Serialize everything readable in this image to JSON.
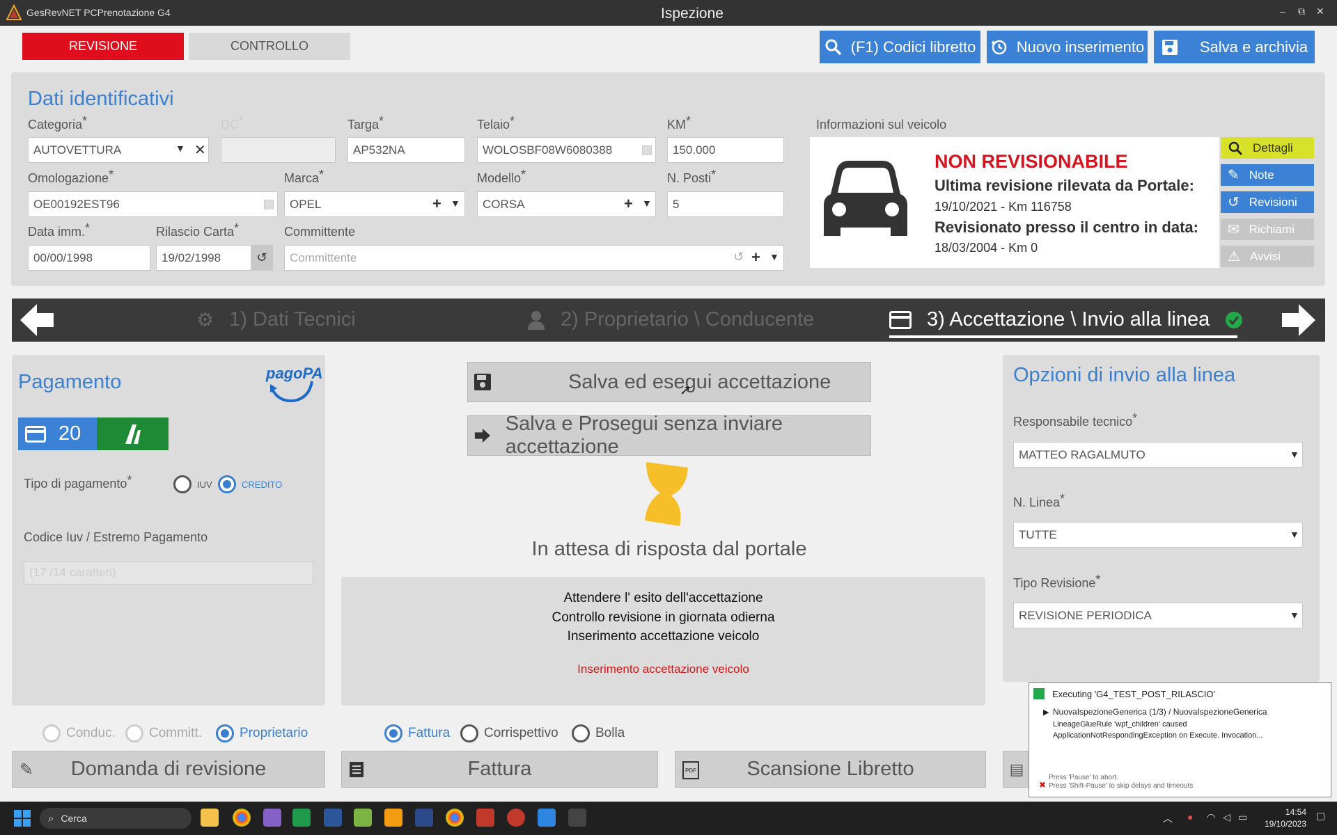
{
  "window": {
    "app_title": "GesRevNET PCPrenotazione G4",
    "title": "Ispezione",
    "controls": [
      "–",
      "⧉",
      "✕"
    ]
  },
  "header": {
    "tab_revisione": "REVISIONE",
    "tab_controllo": "CONTROLLO",
    "btn_codici": "(F1) Codici libretto",
    "btn_nuovo": "Nuovo inserimento",
    "btn_salva": "Salva e archivia"
  },
  "dati": {
    "title": "Dati identificativi",
    "categoria_label": "Categoria",
    "categoria_value": "AUTOVETTURA",
    "dc_label": "DC",
    "targa_label": "Targa",
    "targa_value": "AP532NA",
    "telaio_label": "Telaio",
    "telaio_value": "WOLOSBF08W6080388",
    "km_label": "KM",
    "km_value": "150.000",
    "omologazione_label": "Omologazione",
    "omologazione_value": "OE00192EST96",
    "marca_label": "Marca",
    "marca_value": "OPEL",
    "modello_label": "Modello",
    "modello_value": "CORSA",
    "posti_label": "N. Posti",
    "posti_value": "5",
    "data_imm_label": "Data imm.",
    "data_imm_value": "00/00/1998",
    "rilascio_label": "Rilascio Carta",
    "rilascio_value": "19/02/1998",
    "committente_label": "Committente",
    "committente_placeholder": "Committente",
    "required": "*"
  },
  "vehicle_info": {
    "label": "Informazioni sul veicolo",
    "status": "NON REVISIONABILE",
    "line1": "Ultima revisione rilevata da Portale:",
    "line1_value": "19/10/2021 - Km 116758",
    "line2": "Revisionato presso il centro in data:",
    "line2_value": "18/03/2004 - Km 0",
    "btn_dettagli": "Dettagli",
    "btn_note": "Note",
    "btn_revisioni": "Revisioni",
    "btn_richiami": "Richiami",
    "btn_avvisi": "Avvisi"
  },
  "steps": {
    "step1": "1) Dati Tecnici",
    "step2": "2) Proprietario \\ Conducente",
    "step3": "3) Accettazione \\ Invio alla linea"
  },
  "pagamento": {
    "title": "Pagamento",
    "logo": "pagoPA",
    "card_count": "20",
    "tipo_label": "Tipo di pagamento",
    "opt_iuv": "IUV",
    "opt_credito": "CREDITO",
    "codice_label": "Codice Iuv / Estremo Pagamento",
    "codice_placeholder": "(17 /14 caratteri)"
  },
  "center": {
    "btn_accettazione": "Salva ed esegui accettazione",
    "btn_prosegui": "Salva e Prosegui senza inviare accettazione",
    "waiting": "In attesa di risposta dal portale",
    "msg1": "Attendere l' esito dell'accettazione",
    "msg2": "Controllo revisione in giornata odierna",
    "msg3": "Inserimento accettazione veicolo",
    "msg_red": "Inserimento accettazione veicolo"
  },
  "opzioni": {
    "title": "Opzioni di invio alla linea",
    "resp_label": "Responsabile tecnico",
    "resp_value": "MATTEO RAGALMUTO",
    "linea_label": "N. Linea",
    "linea_value": "TUTTE",
    "tipo_label": "Tipo Revisione",
    "tipo_value": "REVISIONE PERIODICA"
  },
  "radios": {
    "conduc": "Conduc.",
    "committ": "Committ.",
    "proprietario": "Proprietario",
    "fattura": "Fattura",
    "corrispettivo": "Corrispettivo",
    "bolla": "Bolla"
  },
  "bottom": {
    "btn_domanda": "Domanda di revisione",
    "btn_fattura": "Fattura",
    "btn_scansione": "Scansione Libretto"
  },
  "exec_popup": {
    "title": "Executing 'G4_TEST_POST_RILASCIO'",
    "item": "NuovaIspezioneGenerica (1/3) / NuovaIspezioneGenerica",
    "detail1": "LineageGlueRule 'wpf_children' caused",
    "detail2": "ApplicationNotRespondingException on Execute. Invocation...",
    "hint1": "Press 'Pause' to abort.",
    "hint2": "Press 'Shift-Pause' to skip delays and timeouts"
  },
  "taskbar": {
    "search": "Cerca",
    "time": "14:54",
    "date": "19/10/2023"
  },
  "colors": {
    "accent_blue": "#3b82d6",
    "revisione_red": "#e00d1d",
    "status_red": "#d7141e",
    "dettagli_yellow": "#d8e12a",
    "pay_green": "#1f8a36"
  }
}
